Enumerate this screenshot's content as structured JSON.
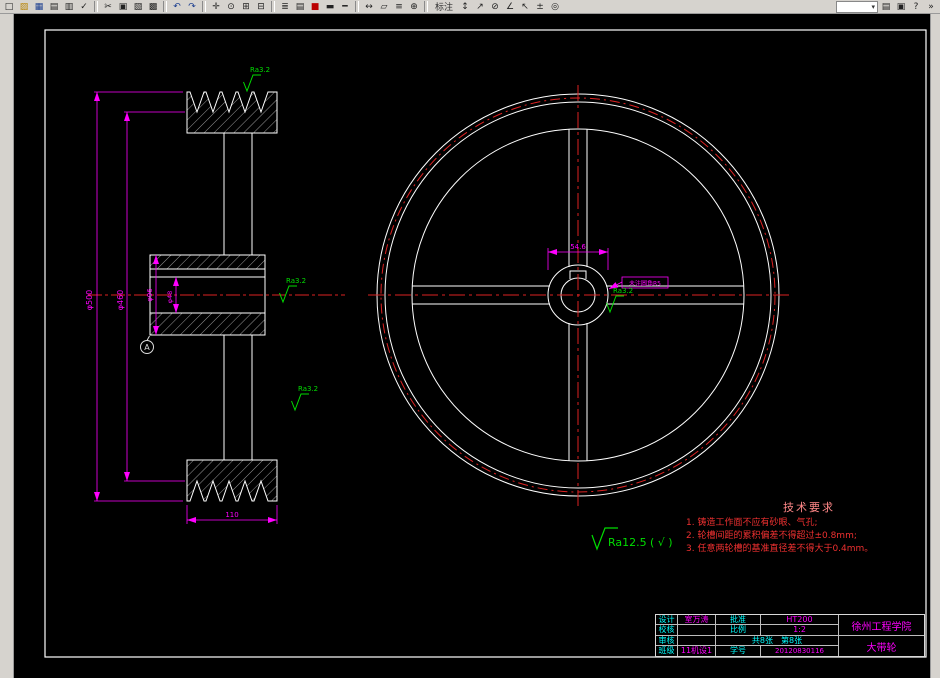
{
  "colors": {
    "line": "#ffffff",
    "centerline": "#dd2222",
    "dimension": "#ff00ff",
    "surface_finish": "#00dd00",
    "label_cyan": "#00ffff",
    "toolbar_bg": "#d6d3ce",
    "canvas_bg": "#000000"
  },
  "toolbar": {
    "caption": "标注",
    "combo_value": "",
    "overflow": "»",
    "icons": [
      {
        "name": "new-file",
        "glyph": "□"
      },
      {
        "name": "open-file",
        "glyph": "▨"
      },
      {
        "name": "save",
        "glyph": "▦"
      },
      {
        "name": "print",
        "glyph": "▤"
      },
      {
        "name": "plot-preview",
        "glyph": "▥"
      },
      {
        "name": "spell-check",
        "glyph": "✓"
      },
      {
        "name": "cut",
        "glyph": "✂"
      },
      {
        "name": "copy",
        "glyph": "▣"
      },
      {
        "name": "paste",
        "glyph": "▧"
      },
      {
        "name": "match-properties",
        "glyph": "▩"
      },
      {
        "name": "undo",
        "glyph": "↶"
      },
      {
        "name": "redo",
        "glyph": "↷"
      },
      {
        "name": "pan",
        "glyph": "✛"
      },
      {
        "name": "zoom-realtime",
        "glyph": "⊙"
      },
      {
        "name": "zoom-window",
        "glyph": "⊞"
      },
      {
        "name": "zoom-previous",
        "glyph": "⊟"
      },
      {
        "name": "layers",
        "glyph": "≣"
      },
      {
        "name": "layer-states",
        "glyph": "▤"
      },
      {
        "name": "color-swatch",
        "glyph": "■"
      },
      {
        "name": "linetype",
        "glyph": "▬"
      },
      {
        "name": "lineweight",
        "glyph": "━"
      },
      {
        "name": "distance",
        "glyph": "↔"
      },
      {
        "name": "area",
        "glyph": "▱"
      },
      {
        "name": "list",
        "glyph": "≡"
      },
      {
        "name": "point-id",
        "glyph": "⊕"
      },
      {
        "name": "dim-linear",
        "glyph": "↕"
      },
      {
        "name": "dim-aligned",
        "glyph": "↗"
      },
      {
        "name": "dim-diameter",
        "glyph": "⊘"
      },
      {
        "name": "dim-angular",
        "glyph": "∠"
      },
      {
        "name": "leader",
        "glyph": "↖"
      },
      {
        "name": "tolerance",
        "glyph": "±"
      },
      {
        "name": "center-mark",
        "glyph": "◎"
      },
      {
        "name": "properties",
        "glyph": "▤"
      },
      {
        "name": "design-center",
        "glyph": "▣"
      },
      {
        "name": "help",
        "glyph": "?"
      }
    ]
  },
  "drawing": {
    "dims": {
      "outer_dia": "φ500",
      "groove_dia": "φ460",
      "hub_dia": "φ96",
      "bore_dia": "φ48",
      "width": "110",
      "hub_len": "54.6"
    },
    "surface": {
      "ra_groove": "Ra3.2",
      "ra_hub_face": "Ra3.2",
      "ra_web": "Ra3.2",
      "ra_bore": "Ra3.2",
      "ra_general": "Ra12.5",
      "ra_general_paren": "( √ )"
    },
    "datum": "A",
    "fillet_note": "未注圆角R5",
    "tech_req": {
      "title": "技术要求",
      "items": [
        "1. 铸造工作面不应有砂眼、气孔;",
        "2. 轮槽间距的累积偏差不得超过±0.8mm;",
        "3. 任意两轮槽的基准直径差不得大于0.4mm。"
      ]
    }
  },
  "title_block": {
    "design_label": "设计",
    "designer": "室万涛",
    "approve_label": "批准",
    "material": "HT200",
    "check_label": "校核",
    "scale_label": "比例",
    "scale_value": "1:2",
    "audit_label": "审核",
    "sheet_total": "共8张",
    "sheet_no": "第8张",
    "class_label": "班级",
    "class_value": "11机设1",
    "student_label": "学号",
    "student_id": "20120830116",
    "school": "徐州工程学院",
    "part": "大带轮"
  }
}
